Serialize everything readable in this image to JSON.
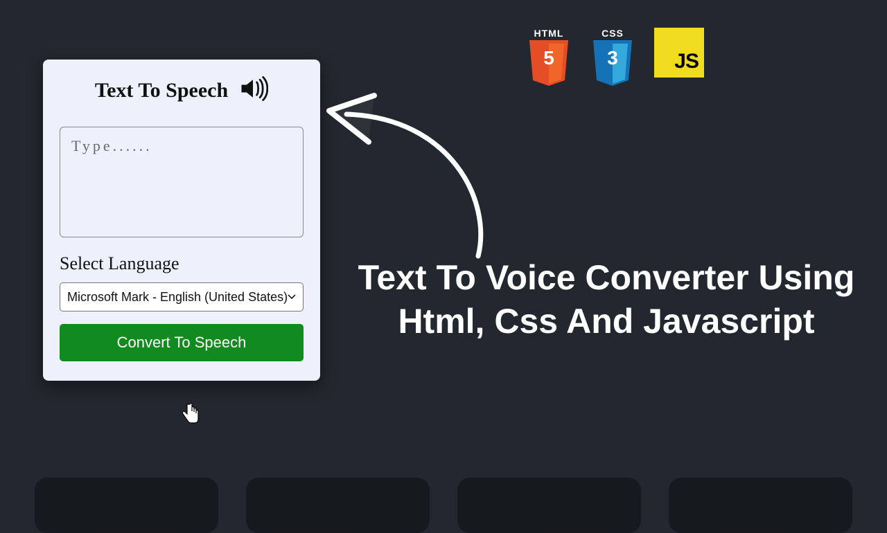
{
  "badges": {
    "html": {
      "label": "HTML",
      "glyph": "5",
      "color": "#e44d26"
    },
    "css": {
      "label": "CSS",
      "glyph": "3",
      "color": "#1572b6"
    },
    "js": {
      "glyph": "JS",
      "color": "#f0db1e"
    }
  },
  "card": {
    "title": "Text To Speech",
    "textarea_placeholder": "Type......",
    "textarea_value": "",
    "select_label": "Select Language",
    "select_value": "Microsoft Mark - English (United States)",
    "convert_label": "Convert To Speech"
  },
  "headline": "Text To Voice Converter Using Html, Css And Javascript",
  "icons": {
    "speaker": "speaker-icon",
    "cursor": "hand-cursor-icon",
    "arrow": "hand-drawn-arrow-icon"
  },
  "colors": {
    "page_bg": "#23272f",
    "card_bg": "#eef1fb",
    "button_bg": "#118a1f",
    "button_fg": "#ffffff"
  }
}
